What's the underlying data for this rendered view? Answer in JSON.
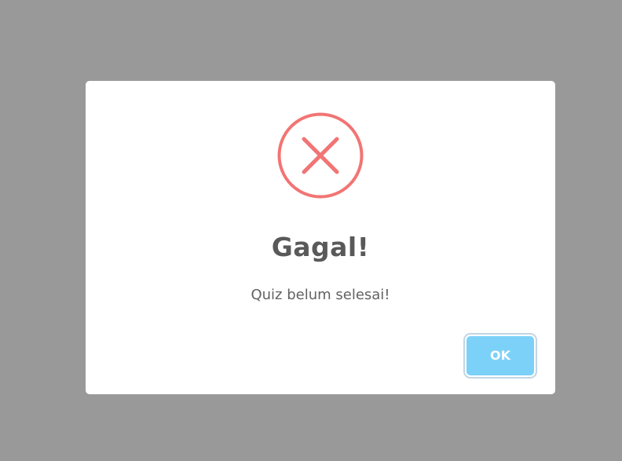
{
  "dialog": {
    "icon": "error-x-icon",
    "title": "Gagal!",
    "text": "Quiz belum selesai!",
    "confirm_label": "OK"
  },
  "colors": {
    "backdrop": "#999999",
    "modal_background": "#ffffff",
    "error_accent": "#f27474",
    "title_text": "#595959",
    "body_text": "#626262",
    "button_background": "#7cd1f9",
    "button_text": "#ffffff"
  }
}
